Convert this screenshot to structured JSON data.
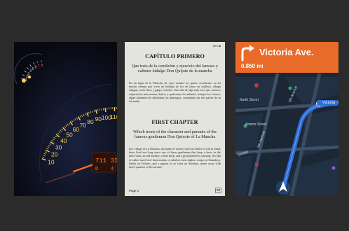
{
  "speedometer": {
    "tach_labels": [
      "1",
      "2",
      "3",
      "4",
      "5",
      "6",
      "7",
      "8"
    ],
    "speed_labels": [
      "10",
      "20",
      "30",
      "40",
      "50",
      "60",
      "70",
      "80",
      "90",
      "100",
      "110",
      "120",
      "130",
      "140"
    ],
    "odometer": "711 33",
    "gear": "D",
    "trip_right": "4",
    "colors": {
      "needle": "#ff6a1f",
      "ticks": "#ffd24a",
      "lcd": "#ff7a2e"
    }
  },
  "ebook": {
    "status": "98% ■",
    "chapter1_title": "CAPÍTULO PRIMERO",
    "chapter1_subtitle": "Que trata de la condición y ejercicio del famoso y valiente hidalgo Don Quijote de la mancha",
    "chapter1_body": "En un lugar de la Mancha, de cuyo nombre no quiero acordarme, no ha mucho tiempo que vivía un hidalgo de los de lanza en astillero, adarga antigua, rocín flaco y galgo corredor. Una olla de algo más vaca que carnero, salpicón las más noches, duelos y quebrantos los sábados, lentejas los viernes, algún palomino de añadidura los domingos, consumían las tres partes de su hacienda.",
    "chapter2_title": "FIRST CHAPTER",
    "chapter2_subtitle": "Which treats of the character and pursuits of the famous gentleman Don Quixote of La Mancha",
    "chapter2_body": "In a village of La Mancha, the name of which I have no desire to call to mind, there lived not long since one of those gentlemen that keep a lance in the lance-rack, an old buckler, a lean hack, and a greyhound for coursing. An olla of rather more beef than mutton, a salad on most nights, scraps on Saturdays, lentils on Fridays, and a pigeon or so extra on Sundays, made away with three-quarters of his income.",
    "page_label": "Page 1"
  },
  "navigation": {
    "street": "Victoria Ave.",
    "distance": "0.850 mi",
    "street_labels": [
      "North Street",
      "Adams Street",
      "5th Avenue",
      "6th Avenue",
      "Street"
    ],
    "destination_chip": "Victoria",
    "colors": {
      "banner": "#e96b2a",
      "route": "#2f6fd6",
      "map_bg": "#1c2735"
    }
  }
}
